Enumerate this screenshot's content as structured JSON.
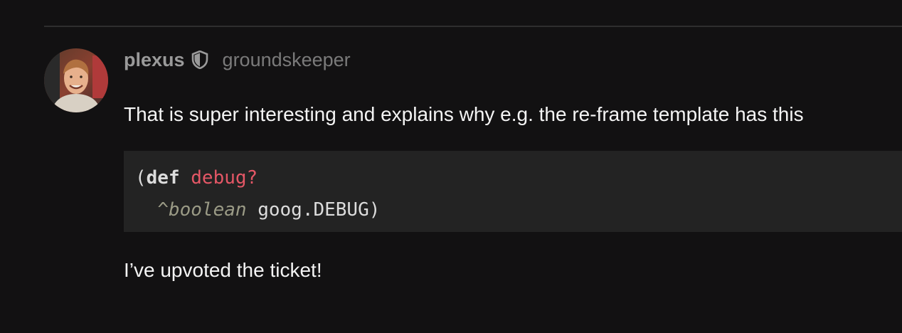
{
  "post": {
    "author": {
      "username": "plexus",
      "title": "groundskeeper",
      "badge_icon": "shield-icon",
      "avatar": "user-avatar"
    },
    "paragraphs": [
      "That is super interesting and explains why e.g. the re-frame template has this",
      "I’ve upvoted the ticket!"
    ],
    "code": {
      "line1": {
        "open_paren": "(",
        "keyword": "def",
        "space": " ",
        "symbol": "debug?"
      },
      "line2": {
        "indent": "  ",
        "type_hint": "^boolean",
        "space": " ",
        "value": "goog.DEBUG",
        "close_paren": ")"
      }
    }
  },
  "colors": {
    "background": "#121112",
    "code_background": "#232323",
    "symbol": "#e45766",
    "type_hint": "#9b9b86",
    "username": "#9a9a9a"
  }
}
